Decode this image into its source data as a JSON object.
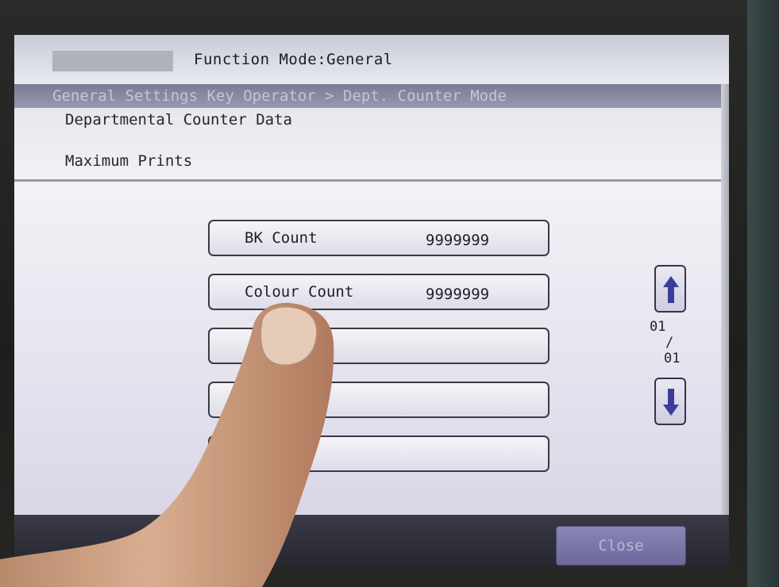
{
  "header": {
    "function_mode": "Function Mode:General"
  },
  "breadcrumb": {
    "text": "General Settings Key Operator > Dept. Counter Mode"
  },
  "title": {
    "main": "Departmental Counter Data",
    "sub": "Maximum Prints"
  },
  "counters": [
    {
      "label": "BK Count",
      "value": "9999999"
    },
    {
      "label": "Colour Count",
      "value": "9999999"
    },
    {
      "label": "",
      "value": ""
    },
    {
      "label": "",
      "value": ""
    },
    {
      "label": "",
      "value": ""
    }
  ],
  "pager": {
    "current": "01",
    "separator": "/",
    "total": "01",
    "up_icon": "arrow-up-icon",
    "down_icon": "arrow-down-icon"
  },
  "footer": {
    "close_label": "Close"
  },
  "colors": {
    "screen_bg": "#d9dde6",
    "breadcrumb_bg": "#8a89a3",
    "close_button": "#7a76a8",
    "footer_bg": "#2c2c36"
  }
}
